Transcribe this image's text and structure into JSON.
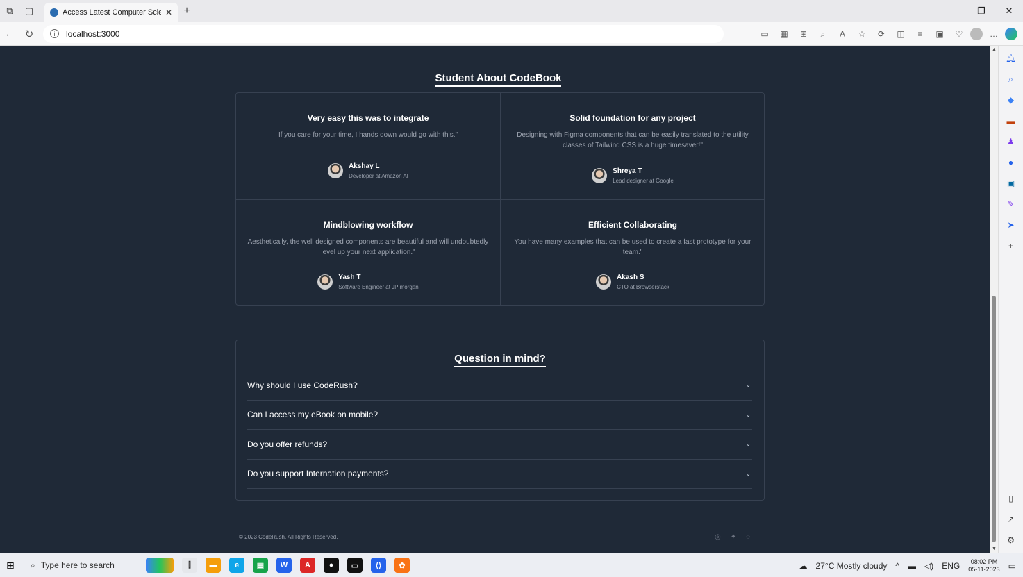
{
  "browser": {
    "tab_title": "Access Latest Computer Science",
    "tab_close": "✕",
    "new_tab": "+",
    "url": "localhost:3000"
  },
  "testimonials": {
    "title": "Student About CodeBook",
    "items": [
      {
        "heading": "Very easy this was to integrate",
        "text": "If you care for your time, I hands down would go with this.\"",
        "name": "Akshay L",
        "role": "Developer at Amazon AI"
      },
      {
        "heading": "Solid foundation for any project",
        "text": "Designing with Figma components that can be easily translated to the utility classes of Tailwind CSS is a huge timesaver!\"",
        "name": "Shreya T",
        "role": "Lead designer at Google"
      },
      {
        "heading": "Mindblowing workflow",
        "text": "Aesthetically, the well designed components are beautiful and will undoubtedly level up your next application.\"",
        "name": "Yash T",
        "role": "Software Engineer at JP morgan"
      },
      {
        "heading": "Efficient Collaborating",
        "text": "You have many examples that can be used to create a fast prototype for your team.\"",
        "name": "Akash S",
        "role": "CTO at Browserstack"
      }
    ]
  },
  "faq": {
    "title": "Question in mind?",
    "items": [
      {
        "question": "Why should I use CodeRush?"
      },
      {
        "question": "Can I access my eBook on mobile?"
      },
      {
        "question": "Do you offer refunds?"
      },
      {
        "question": "Do you support Internation payments?"
      }
    ]
  },
  "footer": {
    "copyright": "© 2023 CodeRush. All Rights Reserved."
  },
  "taskbar": {
    "search_placeholder": "Type here to search",
    "weather": "27°C  Mostly cloudy",
    "lang": "ENG",
    "time": "08:02 PM",
    "date": "05-11-2023"
  }
}
